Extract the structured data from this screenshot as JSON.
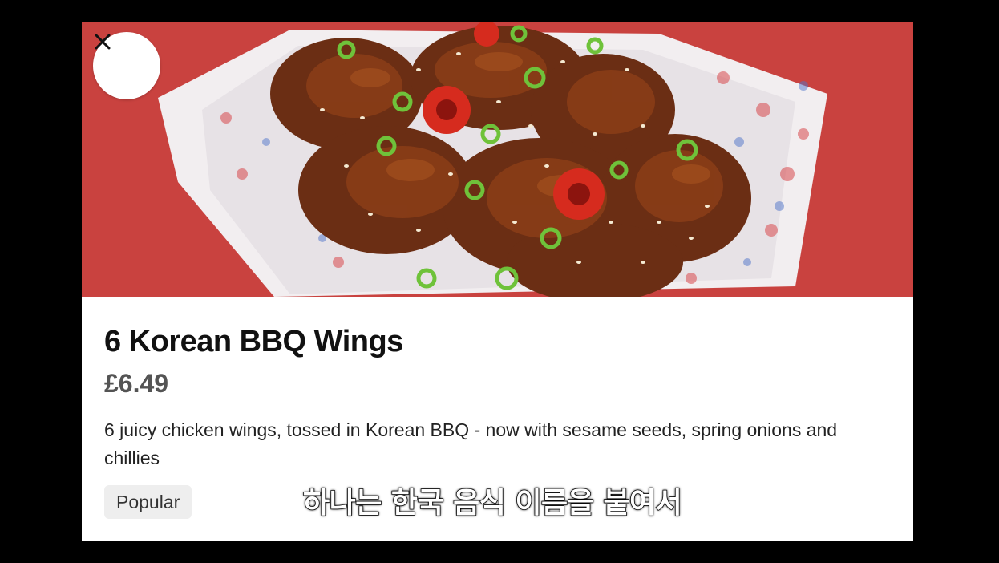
{
  "modal": {
    "close_label": "×"
  },
  "item": {
    "title": "6 Korean BBQ Wings",
    "price": "£6.49",
    "description": "6 juicy chicken wings, tossed in Korean BBQ - now with sesame seeds, spring onions and chillies",
    "badge": "Popular"
  },
  "video": {
    "subtitle": "하나는 한국 음식 이름을 붙여서"
  },
  "icons": {
    "close": "close-icon"
  },
  "colors": {
    "background": "#000000",
    "card": "#ffffff",
    "hero_red": "#c9423f",
    "title": "#111111",
    "price": "#545454",
    "badge_bg": "#eeeeee"
  }
}
